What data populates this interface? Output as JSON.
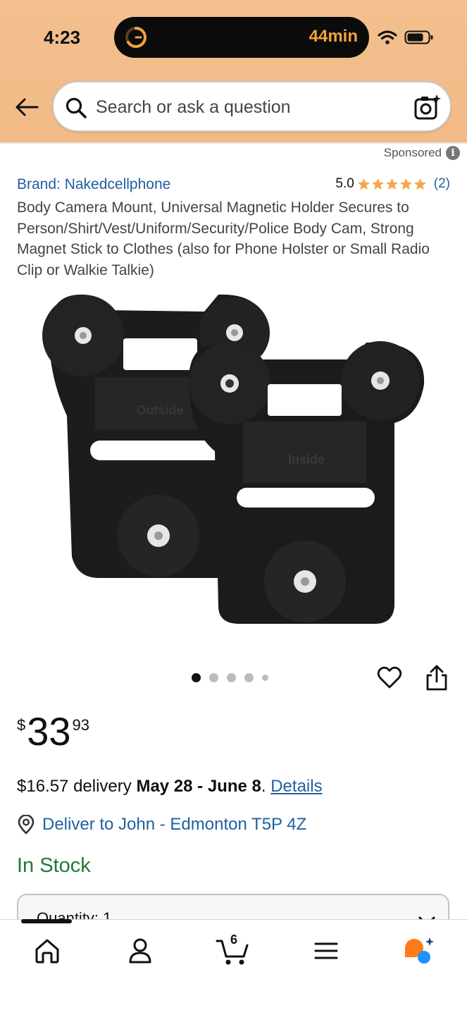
{
  "status_bar": {
    "time": "4:23",
    "live_activity": "44min",
    "icons": [
      "timer-icon",
      "wifi-icon",
      "battery-icon"
    ]
  },
  "search": {
    "placeholder": "Search or ask a question",
    "icons": [
      "back-arrow-icon",
      "search-icon",
      "camera-search-icon"
    ]
  },
  "sponsored": {
    "label": "Sponsored",
    "info_glyph": "i"
  },
  "product": {
    "brand": "Brand: Nakedcellphone",
    "rating_value": "5.0",
    "rating_stars": 5,
    "rating_count": "(2)",
    "title": "Body Camera Mount, Universal Magnetic Holder Secures to Person/Shirt/Vest/Uniform/Security/Police Body Cam, Strong Magnet Stick to Clothes (also for Phone Holster or Small Radio Clip or Walkie Talkie)",
    "image_labels": [
      "Outside",
      "Inside"
    ],
    "gallery_count": 5,
    "gallery_active": 1
  },
  "price": {
    "symbol": "$",
    "whole": "33",
    "fraction": "93"
  },
  "delivery": {
    "cost": "$16.57 delivery ",
    "dates": "May 28 - June 8",
    "suffix": ". ",
    "details_link": "Details"
  },
  "deliver_to": "Deliver to John - Edmonton T5P 4Z",
  "stock_status": "In Stock",
  "quantity": {
    "label": "Quantity: 1"
  },
  "bottom_nav": {
    "items": [
      "home-icon",
      "account-icon",
      "cart-icon",
      "menu-icon",
      "rufus-ai-icon"
    ],
    "cart_count": "6",
    "active": "home"
  },
  "colors": {
    "header_bg": "#f3c08e",
    "link": "#20609e",
    "in_stock": "#1f7a3a",
    "star": "#f3a847",
    "island_text": "#f1a33c",
    "ai_orange": "#ff7a1a",
    "ai_blue": "#1e90ff"
  }
}
